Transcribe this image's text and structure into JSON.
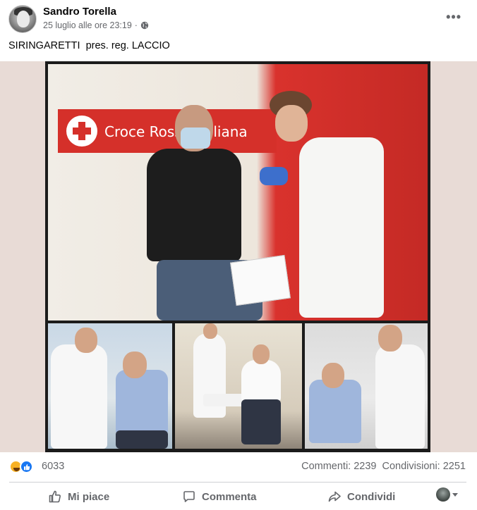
{
  "post": {
    "author": "Sandro Torella",
    "timestamp": "25 luglio alle ore 23:19",
    "privacy_icon": "globe-icon",
    "more_label": "•••",
    "text": "SIRINGARETTI  pres. reg. LACCIO"
  },
  "photo": {
    "banner_text": "Croce Rossa Italiana"
  },
  "reactions": {
    "icons": [
      "haha-icon",
      "like-icon"
    ],
    "count": "6033",
    "comments": "Commenti: 2239",
    "shares": "Condivisioni: 2251"
  },
  "actions": {
    "like_label": "Mi piace",
    "comment_label": "Commenta",
    "share_label": "Condividi"
  },
  "colors": {
    "like_blue": "#1877f2",
    "secondary_text": "#65676b",
    "red_cross": "#d5302a"
  }
}
